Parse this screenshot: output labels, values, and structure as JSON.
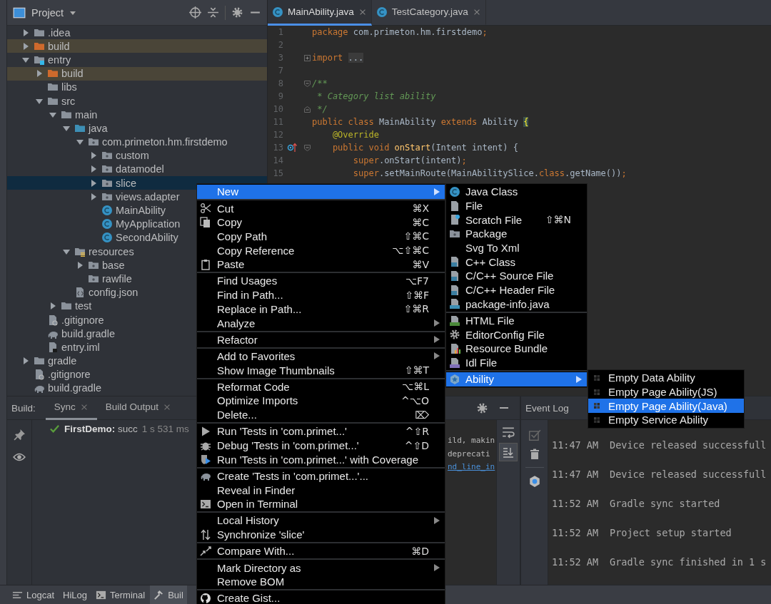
{
  "project": {
    "title": "Project",
    "tree": [
      {
        "label": ".idea",
        "kind": "folder",
        "expanded": false,
        "selected": false
      },
      {
        "label": "build",
        "kind": "excluded",
        "expanded": false,
        "selected": false
      },
      {
        "label": "entry",
        "kind": "module",
        "expanded": true,
        "selected": false,
        "children": [
          {
            "label": "build",
            "kind": "excluded",
            "expanded": false,
            "selected": false
          },
          {
            "label": "libs",
            "kind": "folder",
            "selected": false
          },
          {
            "label": "src",
            "kind": "folder",
            "expanded": true,
            "selected": false,
            "children": [
              {
                "label": "main",
                "kind": "folder",
                "expanded": true,
                "selected": false,
                "children": [
                  {
                    "label": "java",
                    "kind": "source",
                    "expanded": true,
                    "selected": false,
                    "children": [
                      {
                        "label": "com.primeton.hm.firstdemo",
                        "kind": "package",
                        "expanded": true,
                        "selected": false,
                        "children": [
                          {
                            "label": "custom",
                            "kind": "package",
                            "expanded": false,
                            "selected": false
                          },
                          {
                            "label": "datamodel",
                            "kind": "package",
                            "expanded": false,
                            "selected": false
                          },
                          {
                            "label": "slice",
                            "kind": "package",
                            "expanded": false,
                            "selected": true
                          },
                          {
                            "label": "views.adapter",
                            "kind": "package",
                            "expanded": false,
                            "selected": false
                          },
                          {
                            "label": "MainAbility",
                            "kind": "class",
                            "selected": false
                          },
                          {
                            "label": "MyApplication",
                            "kind": "class",
                            "selected": false
                          },
                          {
                            "label": "SecondAbility",
                            "kind": "class",
                            "selected": false
                          }
                        ]
                      }
                    ]
                  },
                  {
                    "label": "resources",
                    "kind": "resources",
                    "expanded": true,
                    "selected": false,
                    "children": [
                      {
                        "label": "base",
                        "kind": "package",
                        "expanded": false,
                        "selected": false
                      },
                      {
                        "label": "rawfile",
                        "kind": "package",
                        "selected": false
                      }
                    ]
                  },
                  {
                    "label": "config.json",
                    "kind": "json",
                    "selected": false
                  }
                ]
              },
              {
                "label": "test",
                "kind": "folder",
                "expanded": false,
                "selected": false
              }
            ]
          },
          {
            "label": ".gitignore",
            "kind": "gitignore",
            "selected": false
          },
          {
            "label": "build.gradle",
            "kind": "gradle",
            "selected": false
          },
          {
            "label": "entry.iml",
            "kind": "iml",
            "selected": false
          }
        ]
      },
      {
        "label": "gradle",
        "kind": "folder",
        "expanded": false,
        "selected": false
      },
      {
        "label": ".gitignore",
        "kind": "gitignore",
        "selected": false
      },
      {
        "label": "build.gradle",
        "kind": "gradle",
        "selected": false
      }
    ]
  },
  "editor": {
    "tabs": [
      {
        "label": "MainAbility.java",
        "selected": true
      },
      {
        "label": "TestCategory.java",
        "selected": false
      }
    ],
    "lines": [
      {
        "number": "1",
        "kind": "plain",
        "tokens": [
          {
            "text": "package ",
            "kind": "keyword"
          },
          {
            "text": "com.primeton.hm.firstdemo",
            "kind": "plain"
          },
          {
            "text": ";",
            "kind": "keyword"
          }
        ]
      },
      {
        "number": "2",
        "kind": "plain"
      },
      {
        "number": "3",
        "kind": "folded",
        "tokens": [
          {
            "text": "import ",
            "kind": "keyword"
          },
          {
            "text": "...",
            "kind": "folded"
          }
        ]
      },
      {
        "number": "7",
        "kind": "plain"
      },
      {
        "number": "8",
        "kind": "fold-start",
        "tokens": [
          {
            "text": "/**",
            "kind": "doc"
          }
        ]
      },
      {
        "number": "9",
        "kind": "plain",
        "tokens": [
          {
            "text": " * Category list ability",
            "kind": "doc"
          }
        ]
      },
      {
        "number": "10",
        "kind": "fold-end",
        "tokens": [
          {
            "text": " */",
            "kind": "doc"
          }
        ]
      },
      {
        "number": "11",
        "kind": "plain",
        "tokens": [
          {
            "text": "public class ",
            "kind": "keyword"
          },
          {
            "text": "MainAbility ",
            "kind": "plain"
          },
          {
            "text": "extends ",
            "kind": "keyword"
          },
          {
            "text": "Ability ",
            "kind": "plain"
          },
          {
            "text": "{",
            "kind": "brace"
          }
        ]
      },
      {
        "number": "12",
        "kind": "plain",
        "tokens": [
          {
            "text": "    @Override",
            "kind": "annotation"
          }
        ]
      },
      {
        "number": "13",
        "kind": "override",
        "tokens": [
          {
            "text": "    public void ",
            "kind": "keyword"
          },
          {
            "text": "onStart",
            "kind": "method"
          },
          {
            "text": "(Intent intent) {",
            "kind": "plain"
          }
        ]
      },
      {
        "number": "14",
        "kind": "plain",
        "tokens": [
          {
            "text": "        super",
            "kind": "keyword"
          },
          {
            "text": ".onStart(intent)",
            "kind": "plain"
          },
          {
            "text": ";",
            "kind": "keyword"
          }
        ]
      },
      {
        "number": "15",
        "kind": "plain",
        "tokens": [
          {
            "text": "        super",
            "kind": "keyword"
          },
          {
            "text": ".setMainRoute(MainAbilitySlice.",
            "kind": "plain"
          },
          {
            "text": "class",
            "kind": "keyword"
          },
          {
            "text": ".getName())",
            "kind": "plain"
          },
          {
            "text": ";",
            "kind": "keyword"
          }
        ]
      }
    ]
  },
  "build": {
    "label": "Build:",
    "tabs": [
      {
        "label": "Sync",
        "selected": true
      },
      {
        "label": "Build Output",
        "selected": false
      }
    ],
    "result": {
      "kind": "success",
      "text": "**FirstDemo:** succ",
      "time": "1 s 531 ms"
    },
    "output": [
      {
        "text": "ild, makin",
        "kind": "plain"
      },
      {
        "text": "deprecati",
        "kind": "plain"
      },
      {
        "text": "nd_line_in",
        "kind": "link"
      }
    ]
  },
  "event_log": {
    "title": "Event Log",
    "entries": [
      {
        "time": "11:47 AM",
        "message": "Device released successfull"
      },
      {
        "time": "11:47 AM",
        "message": "Device released successfull"
      },
      {
        "time": "11:52 AM",
        "message": "Gradle sync started"
      },
      {
        "time": "11:52 AM",
        "message": "Project setup started"
      },
      {
        "time": "11:52 AM",
        "message": "Gradle sync finished in 1 s"
      }
    ]
  },
  "bottom_bar": {
    "items": [
      {
        "label": "Logcat",
        "kind": "logcat",
        "selected": false
      },
      {
        "label": "HiLog",
        "kind": "text",
        "selected": false
      },
      {
        "label": "Terminal",
        "kind": "terminal",
        "selected": false
      },
      {
        "label": "Buil",
        "kind": "hammer",
        "selected": true
      }
    ]
  },
  "context_menu": {
    "groups": [
      [
        {
          "label": "New",
          "submenu": true,
          "selected": true
        }
      ],
      [
        {
          "label": "Cut",
          "kind": "cut",
          "shortcut": "⌘X",
          "submenu": false,
          "selected": false
        },
        {
          "label": "Copy",
          "kind": "copy",
          "shortcut": "⌘C",
          "submenu": false,
          "selected": false
        },
        {
          "label": "Copy Path",
          "shortcut": "⇧⌘C",
          "submenu": false,
          "selected": false
        },
        {
          "label": "Copy Reference",
          "shortcut": "⌥⇧⌘C",
          "submenu": false,
          "selected": false
        },
        {
          "label": "Paste",
          "kind": "paste",
          "shortcut": "⌘V",
          "submenu": false,
          "selected": false
        }
      ],
      [
        {
          "label": "Find Usages",
          "shortcut": "⌥F7",
          "submenu": false,
          "selected": false
        },
        {
          "label": "Find in Path...",
          "shortcut": "⇧⌘F",
          "submenu": false,
          "selected": false
        },
        {
          "label": "Replace in Path...",
          "shortcut": "⇧⌘R",
          "submenu": false,
          "selected": false
        },
        {
          "label": "Analyze",
          "submenu": true,
          "selected": false
        }
      ],
      [
        {
          "label": "Refactor",
          "submenu": true,
          "selected": false
        }
      ],
      [
        {
          "label": "Add to Favorites",
          "submenu": true,
          "selected": false
        },
        {
          "label": "Show Image Thumbnails",
          "shortcut": "⇧⌘T",
          "submenu": false,
          "selected": false
        }
      ],
      [
        {
          "label": "Reformat Code",
          "shortcut": "⌥⌘L",
          "submenu": false,
          "selected": false
        },
        {
          "label": "Optimize Imports",
          "shortcut": "^⌥O",
          "submenu": false,
          "selected": false
        },
        {
          "label": "Delete...",
          "shortcut": "⌦",
          "submenu": false,
          "selected": false
        }
      ],
      [
        {
          "label": "Run 'Tests in 'com.primet...'",
          "kind": "run",
          "shortcut": "^⇧R",
          "submenu": false,
          "selected": false
        },
        {
          "label": "Debug 'Tests in 'com.primet...'",
          "kind": "debug",
          "shortcut": "^⇧D",
          "submenu": false,
          "selected": false
        },
        {
          "label": "Run 'Tests in 'com.primet...' with Coverage",
          "kind": "coverage",
          "submenu": false,
          "selected": false
        }
      ],
      [
        {
          "label": "Create 'Tests in 'com.primet...'...",
          "kind": "gradle",
          "submenu": false,
          "selected": false
        },
        {
          "label": "Reveal in Finder",
          "submenu": false,
          "selected": false
        },
        {
          "label": "Open in Terminal",
          "kind": "terminal",
          "submenu": false,
          "selected": false
        }
      ],
      [
        {
          "label": "Local History",
          "submenu": true,
          "selected": false
        },
        {
          "label": "Synchronize 'slice'",
          "kind": "sync",
          "submenu": false,
          "selected": false
        }
      ],
      [
        {
          "label": "Compare With...",
          "kind": "compare",
          "shortcut": "⌘D",
          "submenu": false,
          "selected": false
        }
      ],
      [
        {
          "label": "Mark Directory as",
          "submenu": true,
          "selected": false
        },
        {
          "label": "Remove BOM",
          "submenu": false,
          "selected": false
        }
      ],
      [
        {
          "label": "Create Gist...",
          "kind": "github",
          "submenu": false,
          "selected": false
        }
      ]
    ]
  },
  "new_submenu": {
    "groups": [
      [
        {
          "label": "Java Class",
          "kind": "class",
          "submenu": false,
          "selected": false
        },
        {
          "label": "File",
          "kind": "file",
          "submenu": false,
          "selected": false
        },
        {
          "label": "Scratch File",
          "kind": "scratch",
          "shortcut": "⇧⌘N",
          "submenu": false,
          "selected": false
        },
        {
          "label": "Package",
          "kind": "package",
          "submenu": false,
          "selected": false
        },
        {
          "label": "Svg To Xml",
          "submenu": false,
          "selected": false
        },
        {
          "label": "C++ Class",
          "kind": "cpp",
          "submenu": false,
          "selected": false
        },
        {
          "label": "C/C++ Source File",
          "kind": "cpp",
          "submenu": false,
          "selected": false
        },
        {
          "label": "C/C++ Header File",
          "kind": "cpp",
          "submenu": false,
          "selected": false
        },
        {
          "label": "package-info.java",
          "kind": "javafile",
          "submenu": false,
          "selected": false
        }
      ],
      [
        {
          "label": "HTML File",
          "kind": "html",
          "submenu": false,
          "selected": false
        },
        {
          "label": "EditorConfig File",
          "kind": "gear",
          "submenu": false,
          "selected": false
        },
        {
          "label": "Resource Bundle",
          "kind": "bundle",
          "submenu": false,
          "selected": false
        },
        {
          "label": "Idl File",
          "kind": "idl",
          "submenu": false,
          "selected": false
        }
      ],
      [
        {
          "label": "Ability",
          "kind": "ability",
          "submenu": true,
          "selected": true
        }
      ]
    ]
  },
  "ability_submenu": {
    "groups": [
      [
        {
          "label": "Empty Data Ability",
          "kind": "template",
          "submenu": false,
          "selected": false
        },
        {
          "label": "Empty Page Ability(JS)",
          "kind": "template",
          "submenu": false,
          "selected": false
        },
        {
          "label": "Empty Page Ability(Java)",
          "kind": "template",
          "submenu": false,
          "selected": true
        },
        {
          "label": "Empty Service Ability",
          "kind": "template",
          "submenu": false,
          "selected": false
        }
      ]
    ]
  }
}
